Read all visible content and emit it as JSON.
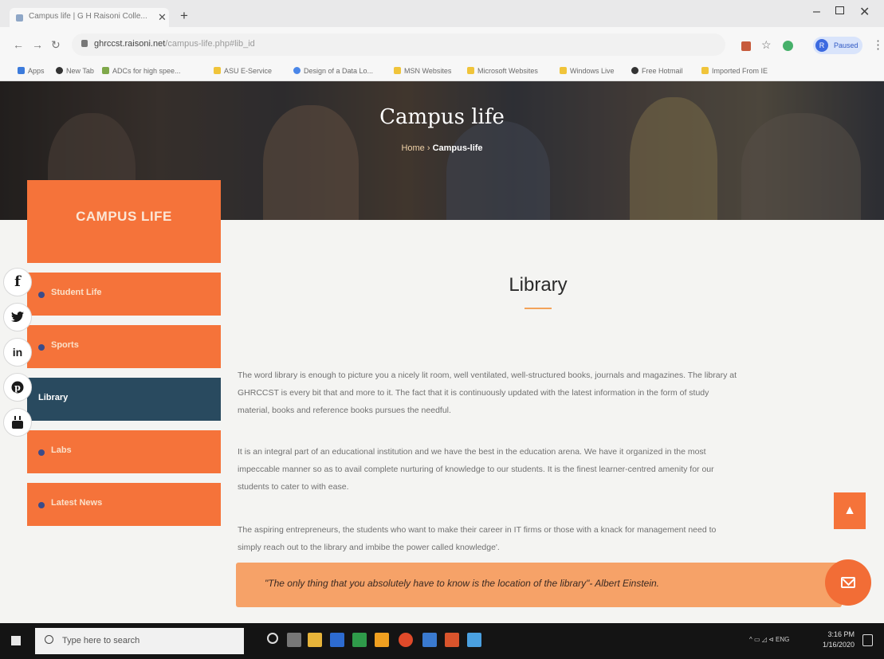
{
  "browser": {
    "tab_title": "Campus life | G H Raisoni Colle...",
    "url_host": "ghrccst.raisoni.net",
    "url_path": "/campus-life.php#lib_id",
    "profile_initial": "R",
    "profile_status": "Paused",
    "bookmarks": [
      "Apps",
      "New Tab",
      "ADCs for high spee...",
      "ASU E-Service",
      "Design of a Data Lo...",
      "MSN Websites",
      "Microsoft Websites",
      "Windows Live",
      "Free Hotmail",
      "Imported From IE"
    ]
  },
  "hero": {
    "title": "Campus life",
    "crumb_home": "Home",
    "crumb_sep": "›",
    "crumb_current": "Campus-life"
  },
  "sidebar": {
    "title": "CAMPUS LIFE",
    "items": [
      {
        "label": "Student Life"
      },
      {
        "label": "Sports"
      },
      {
        "label": "Library"
      },
      {
        "label": "Labs"
      },
      {
        "label": "Latest News"
      }
    ]
  },
  "social": [
    "f",
    "t",
    "in",
    "p",
    "yt"
  ],
  "content": {
    "title": "Library",
    "p1_line1": "The word library is enough to picture you a nicely lit room, well ventilated, well-structured books, journals and magazines. The library at",
    "p1_line2": "GHRCCST is every bit that and more to it. The fact that it is continuously updated with the latest information in the form of study",
    "p1_line3": "material, books and reference books pursues the needful.",
    "p2_line1": "It is an integral part of an educational institution and we have the best in the education arena. We have it organized in the most",
    "p2_line2": "impeccable manner so as to avail complete nurturing of knowledge to our students. It is the finest learner-centred amenity for our",
    "p2_line3": "students to cater to with ease.",
    "p3_line1": "The aspiring entrepreneurs, the students who want to make their career in IT firms or those with a knack for management need to",
    "p3_line2": "simply reach out to the library and imbibe the power called knowledge'.",
    "quote": "\"The only thing that you absolutely have to know is the location of the library\"- Albert Einstein."
  },
  "taskbar": {
    "search_placeholder": "Type here to search",
    "tray": "^ ▭ ◿ ⊲ ENG",
    "time": "3:16 PM",
    "date": "1/16/2020"
  },
  "colors": {
    "accent": "#f5733a",
    "active": "#294a5f"
  }
}
